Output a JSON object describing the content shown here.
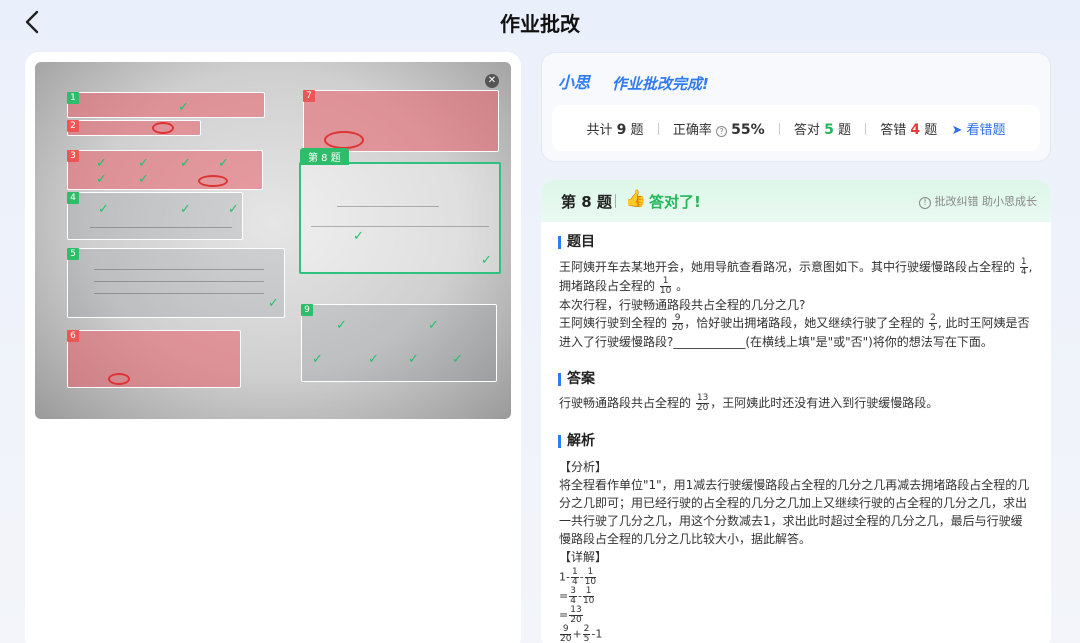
{
  "header": {
    "title": "作业批改"
  },
  "photo": {
    "q8_tag": "第 8 题",
    "close_icon": "close-icon",
    "question_numbers": [
      "1",
      "2",
      "3",
      "4",
      "5",
      "6",
      "7",
      "8",
      "9"
    ],
    "wrong_regions": [
      "1",
      "2",
      "3",
      "6",
      "7"
    ]
  },
  "summary": {
    "brand": "小思",
    "done_text": "作业批改完成!",
    "total_label": "共计",
    "total_value": "9",
    "unit": "题",
    "accuracy_label": "正确率",
    "accuracy_value": "55%",
    "correct_label": "答对",
    "correct_value": "5",
    "wrong_label": "答错",
    "wrong_value": "4",
    "view_wrong_label": "看错题",
    "colors": {
      "accent": "#2f7bf2",
      "correct": "#27b55c",
      "wrong": "#e43b3b"
    }
  },
  "detail": {
    "question_title": "第 8 题",
    "result": "答对了!",
    "feedback": "批改纠错 助小思成长",
    "sections": {
      "question": "题目",
      "answer": "答案",
      "analysis": "解析"
    },
    "question_text": {
      "l1": "王阿姨开车去某地开会，她用导航查看路况，示意图如下。其中行驶缓慢路段占全程的",
      "l1_frac": {
        "num": "1",
        "den": "4"
      },
      "l1_end": ",",
      "l2": "拥堵路段占全程的",
      "l2_frac": {
        "num": "1",
        "den": "10"
      },
      "l2_end": "。",
      "l3": "本次行程，行驶畅通路段共占全程的几分之几?",
      "l4a": "王阿姨行驶到全程的",
      "l4_frac1": {
        "num": "9",
        "den": "20"
      },
      "l4b": "，恰好驶出拥堵路段，她又继续行驶了全程的",
      "l4_frac2": {
        "num": "2",
        "den": "5"
      },
      "l4c": ", 此时王阿姨是否",
      "l5": "进入了行驶缓慢路段?____________(在横线上填\"是\"或\"否\")将你的想法写在下面。"
    },
    "answer_text": {
      "a": "行驶畅通路段共占全程的",
      "frac": {
        "num": "13",
        "den": "20"
      },
      "b": "，王阿姨此时还没有进入到行驶缓慢路段。"
    },
    "analysis_text": {
      "fenxi": "【分析】",
      "p1": "将全程看作单位\"1\"，用1减去行驶缓慢路段占全程的几分之几再减去拥堵路段占全程的几",
      "p2": "分之几即可；用已经行驶的占全程的几分之几加上又继续行驶的占全程的几分之几，求出",
      "p3": "一共行驶了几分之几，用这个分数减去1，求出此时超过全程的几分之几，最后与行驶缓",
      "p4": "慢路段占全程的几分之几比较大小，据此解答。",
      "xiangjie": "【详解】",
      "c1a": "1-",
      "c1f1": {
        "num": "1",
        "den": "4"
      },
      "c1b": "-",
      "c1f2": {
        "num": "1",
        "den": "10"
      },
      "c2a": "=",
      "c2f1": {
        "num": "3",
        "den": "4"
      },
      "c2b": "-",
      "c2f2": {
        "num": "1",
        "den": "10"
      },
      "c3a": "=",
      "c3f1": {
        "num": "13",
        "den": "20"
      },
      "c4f1": {
        "num": "9",
        "den": "20"
      },
      "c4b": "+",
      "c4f2": {
        "num": "2",
        "den": "5"
      },
      "c4c": "-1"
    }
  }
}
